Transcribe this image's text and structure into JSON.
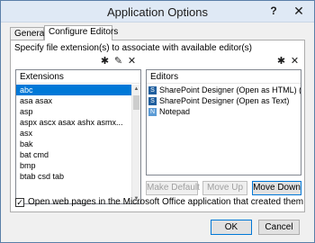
{
  "window": {
    "title": "Application Options",
    "help_glyph": "?",
    "close_glyph": "✕"
  },
  "tabs": [
    {
      "label": "General"
    },
    {
      "label": "Configure Editors"
    }
  ],
  "configure": {
    "instruction": "Specify file extension(s) to associate with available editor(s)",
    "extensions": {
      "header": "Extensions",
      "items": [
        {
          "label": "abc",
          "selected": true
        },
        {
          "label": "asa asax"
        },
        {
          "label": "asp"
        },
        {
          "label": "aspx ascx asax ashx asmx..."
        },
        {
          "label": "asx"
        },
        {
          "label": "bak"
        },
        {
          "label": "bat cmd"
        },
        {
          "label": "bmp"
        },
        {
          "label": "btab csd tab"
        }
      ]
    },
    "editors": {
      "header": "Editors",
      "items": [
        {
          "label": "SharePoint Designer (Open as HTML) (D...",
          "icon": "sharepoint-designer-icon"
        },
        {
          "label": "SharePoint Designer (Open as Text)",
          "icon": "sharepoint-designer-icon"
        },
        {
          "label": "Notepad",
          "icon": "notepad-icon"
        }
      ]
    },
    "buttons": {
      "make_default": "Make Default",
      "move_up": "Move Up",
      "move_down": "Move Down"
    },
    "checkbox": {
      "label": "Open web pages in the Microsoft Office application that created them",
      "checked": true,
      "mark": "✓"
    }
  },
  "footer": {
    "ok": "OK",
    "cancel": "Cancel"
  },
  "icons": {
    "new_glyph": "✱",
    "edit_glyph": "✎",
    "delete_glyph": "✕",
    "scroll_up": "▲",
    "scroll_down": "▼"
  },
  "colors": {
    "selection": "#0078d7",
    "title_bar": "#dfe9f5"
  }
}
